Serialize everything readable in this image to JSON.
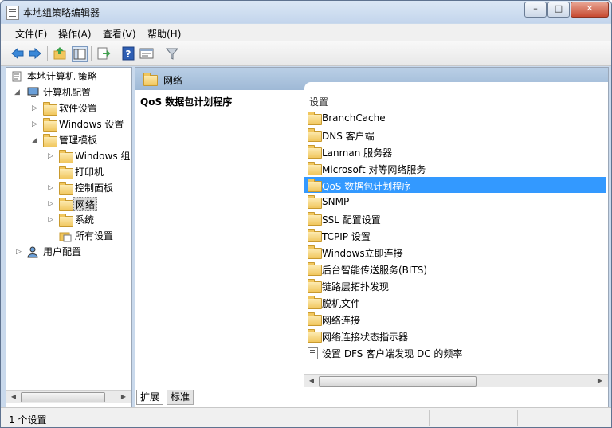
{
  "window": {
    "title": "本地组策略编辑器",
    "buttons": {
      "minimize": "–",
      "maximize": "□",
      "close": "✕"
    }
  },
  "menu": [
    "文件(F)",
    "操作(A)",
    "查看(V)",
    "帮助(H)"
  ],
  "toolbar": {
    "icons": [
      "back-arrow-icon",
      "forward-arrow-icon",
      "up-folder-icon",
      "show-hide-tree-icon",
      "export-list-icon",
      "help-icon",
      "properties-icon",
      "filter-icon"
    ]
  },
  "tree": {
    "items": [
      {
        "label": "本地计算机 策略"
      },
      {
        "label": "计算机配置"
      },
      {
        "label": "软件设置"
      },
      {
        "label": "Windows 设置"
      },
      {
        "label": "管理模板"
      },
      {
        "label": "Windows 组"
      },
      {
        "label": "打印机"
      },
      {
        "label": "控制面板"
      },
      {
        "label": "网络"
      },
      {
        "label": "系统"
      },
      {
        "label": "所有设置"
      },
      {
        "label": "用户配置"
      }
    ]
  },
  "right": {
    "header": "网络",
    "description_title": "QoS 数据包计划程序",
    "column_header": "设置",
    "rows": [
      {
        "label": "BranchCache"
      },
      {
        "label": "DNS 客户端"
      },
      {
        "label": "Lanman 服务器"
      },
      {
        "label": "Microsoft 对等网络服务"
      },
      {
        "label": "QoS 数据包计划程序"
      },
      {
        "label": "SNMP"
      },
      {
        "label": "SSL 配置设置"
      },
      {
        "label": "TCPIP 设置"
      },
      {
        "label": "Windows立即连接"
      },
      {
        "label": "后台智能传送服务(BITS)"
      },
      {
        "label": "链路层拓扑发现"
      },
      {
        "label": "脱机文件"
      },
      {
        "label": "网络连接"
      },
      {
        "label": "网络连接状态指示器"
      },
      {
        "label": "设置 DFS 客户端发现 DC 的频率"
      }
    ]
  },
  "tabs": [
    "扩展",
    "标准"
  ],
  "status": {
    "text": "1 个设置"
  },
  "colors": {
    "selection": "#3399ff",
    "header_bar": "#a9c2de"
  }
}
